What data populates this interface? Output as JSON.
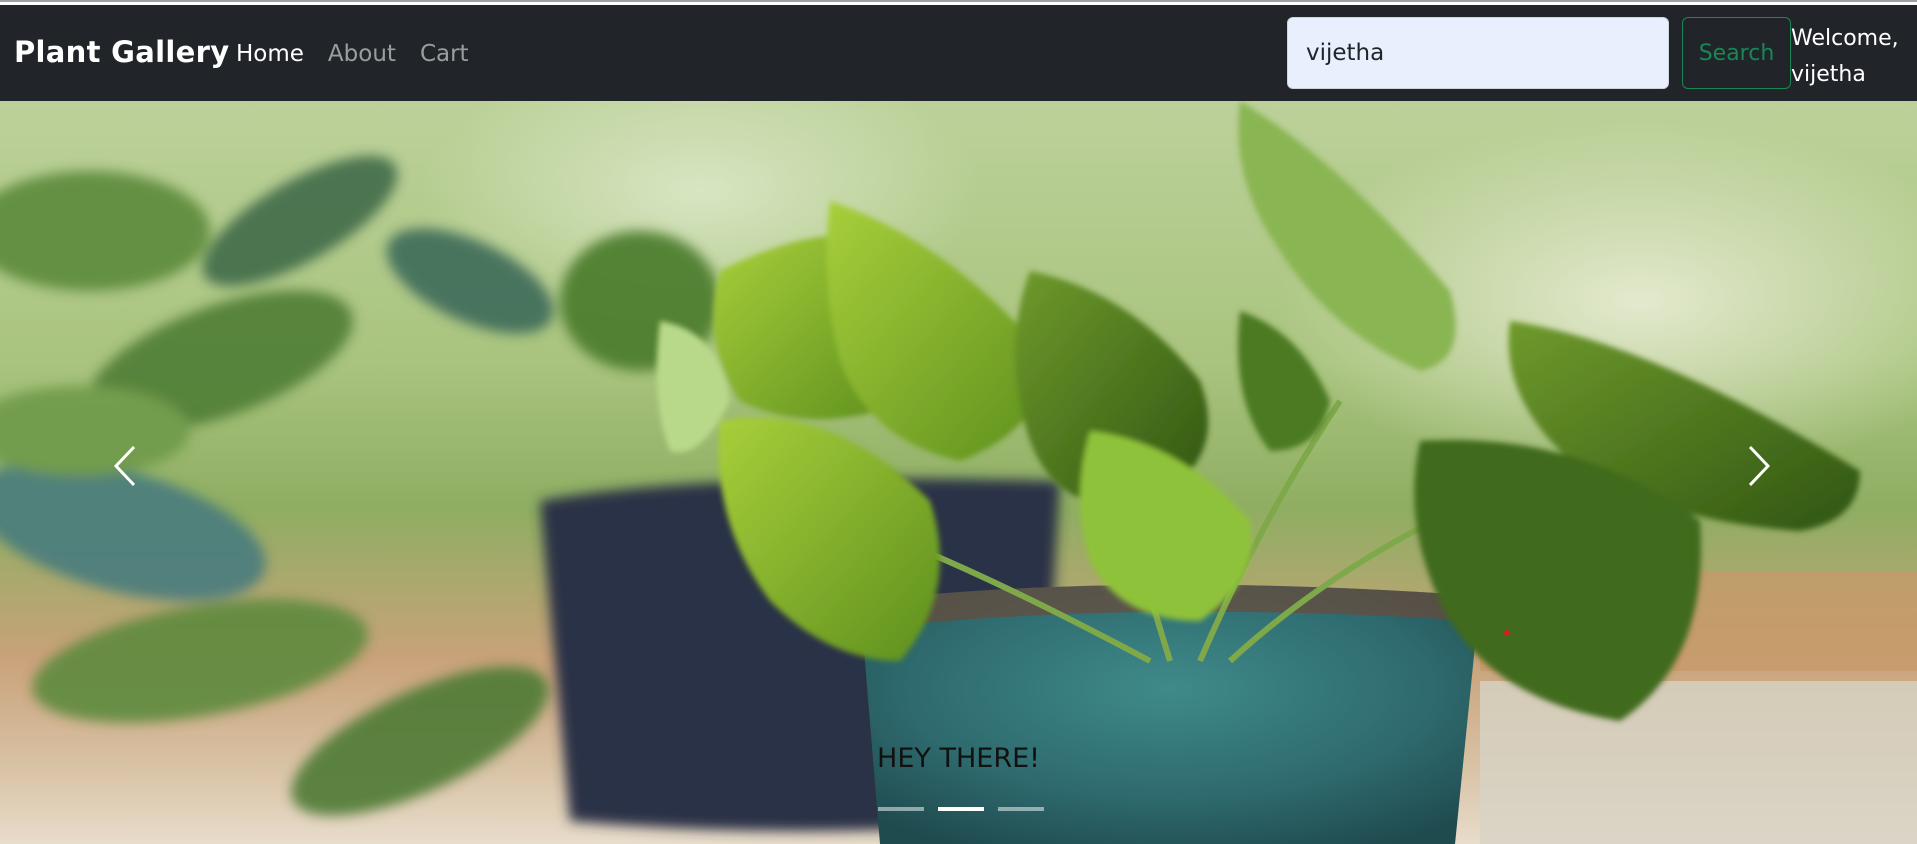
{
  "navbar": {
    "brand": "Plant Gallery",
    "links": [
      "Home",
      "About",
      "Cart"
    ],
    "active_link": "Home",
    "search": {
      "value": "vijetha",
      "button_label": "Search"
    },
    "welcome": [
      "Welcome,",
      "vijetha"
    ]
  },
  "carousel": {
    "caption": "HEY THERE!",
    "slide_count": 3,
    "active_slide": 2,
    "controls": {
      "prev": "chevron-left-icon",
      "next": "chevron-right-icon"
    }
  },
  "colors": {
    "navbar_bg": "#212529",
    "search_field_bg": "#e8f0fe",
    "search_button": "#198754"
  }
}
